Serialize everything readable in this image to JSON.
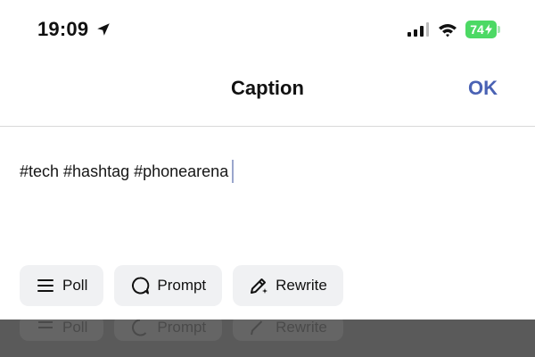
{
  "status_bar": {
    "time": "19:09",
    "battery_level": "74",
    "battery_color": "#4cd964",
    "icons": [
      "location-arrow-icon",
      "cellular-signal-icon",
      "wifi-icon",
      "battery-charging-icon"
    ]
  },
  "nav": {
    "title": "Caption",
    "ok_label": "OK",
    "accent_color": "#4a62b4"
  },
  "caption": {
    "text": "#tech #hashtag #phonearena"
  },
  "chips": [
    {
      "label": "Poll",
      "icon": "list-lines-icon"
    },
    {
      "label": "Prompt",
      "icon": "speech-bubble-icon"
    },
    {
      "label": "Rewrite",
      "icon": "pencil-sparkle-icon"
    }
  ]
}
